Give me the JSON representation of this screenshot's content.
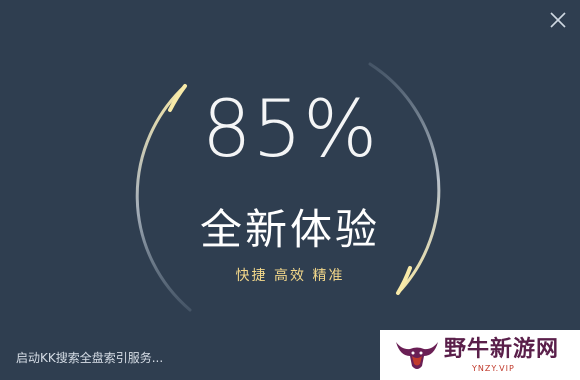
{
  "progress": {
    "percent_text": "85%",
    "value": 0.85
  },
  "headline": "全新体验",
  "tagline": "快捷 高效 精准",
  "status_text": "启动KK搜索全盘索引服务...",
  "close_icon": "close-icon",
  "colors": {
    "background": "#2f3e50",
    "accent_gold": "#f2d78a",
    "ring_silver": "#c7d2dd"
  },
  "watermark": {
    "title": "野牛新游网",
    "subtitle": "YNZY.VIP"
  }
}
